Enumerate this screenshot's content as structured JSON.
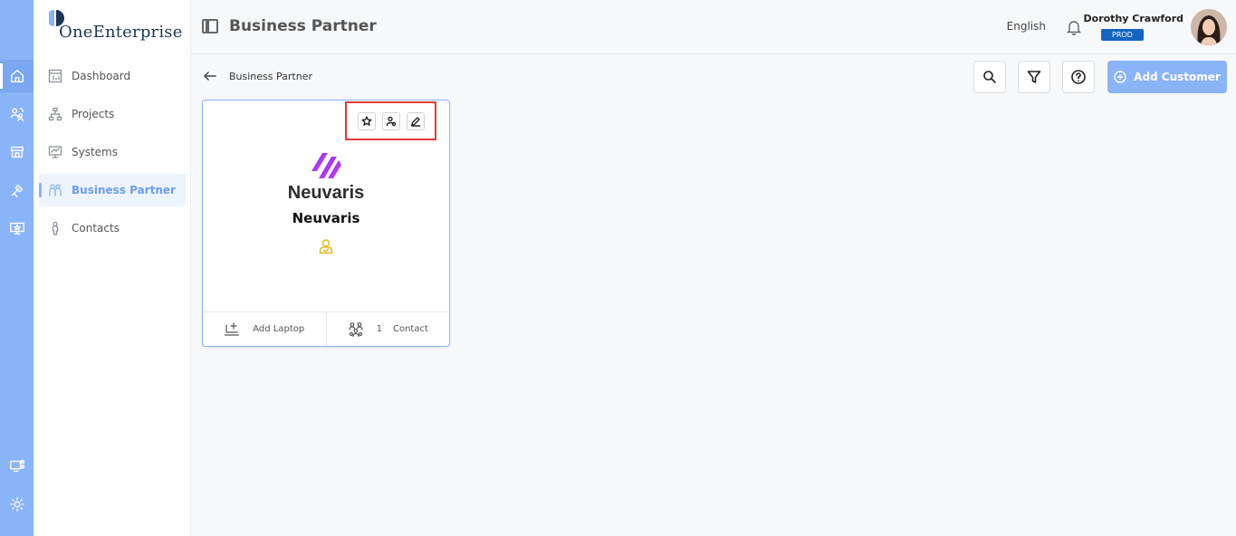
{
  "app": {
    "name": "OneEnterprise",
    "name_prefix": "One",
    "name_suffix": "Enterprise"
  },
  "rail": {
    "items": [
      {
        "icon": "home-icon",
        "active": true
      },
      {
        "icon": "people-sync-icon",
        "active": false
      },
      {
        "icon": "store-icon",
        "active": false
      },
      {
        "icon": "tools-icon",
        "active": false
      },
      {
        "icon": "monitor-star-icon",
        "active": false
      }
    ],
    "bottom": [
      {
        "icon": "qr-monitor-icon"
      },
      {
        "icon": "gear-icon"
      }
    ]
  },
  "sidebar": {
    "items": [
      {
        "label": "Dashboard",
        "icon": "dashboard-icon"
      },
      {
        "label": "Projects",
        "icon": "hierarchy-icon"
      },
      {
        "label": "Systems",
        "icon": "systems-icon"
      },
      {
        "label": "Business Partner",
        "icon": "partner-icon",
        "active": true
      },
      {
        "label": "Contacts",
        "icon": "person-icon"
      }
    ]
  },
  "header": {
    "title": "Business Partner",
    "language": "English",
    "user": {
      "name": "Dorothy Crawford",
      "environment": "PROD"
    }
  },
  "toolbar": {
    "breadcrumb": "Business Partner",
    "add_label": "Add Customer"
  },
  "card": {
    "brand_word": "Neuvaris",
    "name": "Neuvaris",
    "footer": {
      "add_laptop_label": "Add Laptop",
      "contact_count": "1",
      "contact_label": "Contact"
    }
  },
  "colors": {
    "accent": "#8ab4f8",
    "badge": "#1565c0",
    "highlight": "#e53935",
    "owner": "#e2b200"
  }
}
